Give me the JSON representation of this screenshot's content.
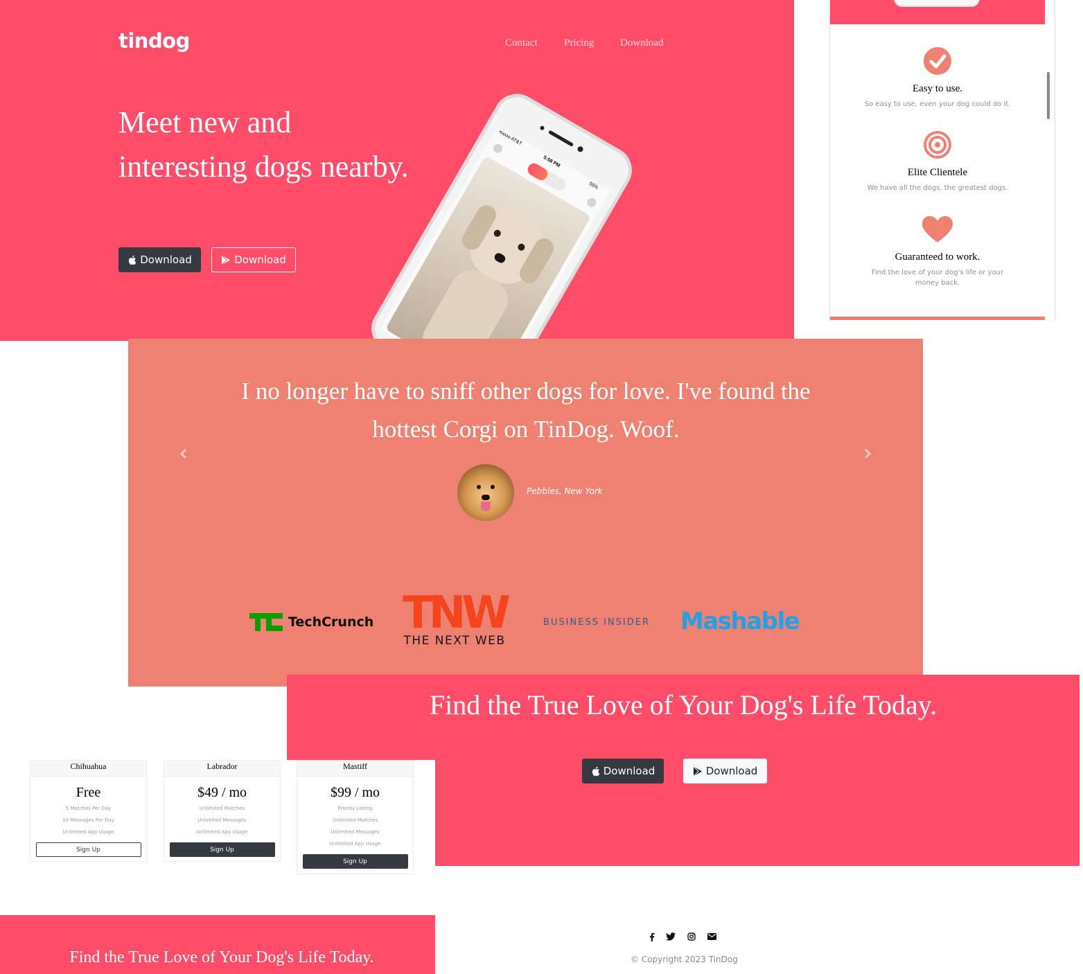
{
  "brand": "tindog",
  "nav": {
    "links": [
      "Contact",
      "Pricing",
      "Download"
    ]
  },
  "hero": {
    "title": "Meet new and interesting dogs nearby.",
    "buttons": {
      "apple": "Download",
      "google": "Download"
    }
  },
  "phone": {
    "carrier": "•oooo AT&T",
    "time": "5:58 PM",
    "battery": "55%"
  },
  "features": [
    {
      "icon": "check-circle-icon",
      "title": "Easy to use.",
      "text": "So easy to use, even your dog could do it."
    },
    {
      "icon": "bullseye-icon",
      "title": "Elite Clientele",
      "text": "We have all the dogs, the greatest dogs."
    },
    {
      "icon": "heart-icon",
      "title": "Guaranteed to work.",
      "text": "Find the love of your dog's life or your money back."
    }
  ],
  "testimonial": {
    "quote": "I no longer have to sniff other dogs for love. I've found the hottest Corgi on TinDog. Woof.",
    "author": "Pebbles, New York"
  },
  "press": {
    "techcrunch": "TechCrunch",
    "tnw_logo": "TNW",
    "tnw_name": "THE NEXT WEB",
    "business_insider": "BUSINESS INSIDER",
    "mashable": "Mashable"
  },
  "cta": {
    "title": "Find the True Love of Your Dog's Life Today.",
    "buttons": {
      "apple": "Download",
      "google": "Download"
    }
  },
  "pricing": [
    {
      "name": "Chihuahua",
      "price": "Free",
      "features": [
        "5 Matches Per Day",
        "10 Messages Per Day",
        "Unlimited App Usage"
      ],
      "button": "Sign Up"
    },
    {
      "name": "Labrador",
      "price": "$49 / mo",
      "features": [
        "Unlimited Matches",
        "Unlimited Messages",
        "Unlimited App Usage"
      ],
      "button": "Sign Up"
    },
    {
      "name": "Mastiff",
      "price": "$99 / mo",
      "features": [
        "Priority Listing",
        "Unlimited Matches",
        "Unlimited Messages",
        "Unlimited App Usage"
      ],
      "button": "Sign Up"
    }
  ],
  "bottom_cta": {
    "title": "Find the True Love of Your Dog's Life Today."
  },
  "footer": {
    "social_icons": [
      "facebook-icon",
      "twitter-icon",
      "instagram-icon",
      "envelope-icon"
    ],
    "copyright": "© Copyright 2023 TinDog"
  },
  "colors": {
    "primary": "#ff4c68",
    "secondary": "#ef8172",
    "dark": "#343a40"
  }
}
